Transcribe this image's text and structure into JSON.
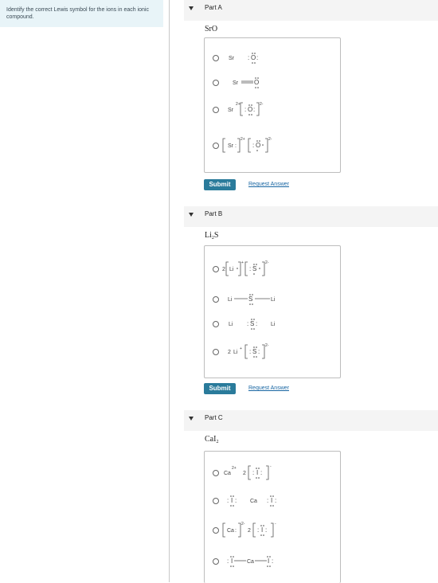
{
  "instructions": "Identify the correct Lewis symbol for the ions in each ionic compound.",
  "parts": [
    {
      "title": "Part A",
      "formula_main": "SrO",
      "formula_sub": "",
      "submit_label": "Submit",
      "request_label": "Request Answer",
      "options": [
        {
          "text": "Sr :O:"
        },
        {
          "text": "Sr=O"
        },
        {
          "text": "Sr 2+ [:O:] 2-"
        },
        {
          "text": "[Sr:] 2+ [:O·] 2-"
        }
      ]
    },
    {
      "title": "Part B",
      "formula_main": "Li",
      "formula_sub": "2",
      "formula_tail": "S",
      "submit_label": "Submit",
      "request_label": "Request Answer",
      "options": [
        {
          "text": "2[Li·]+ [:S·] 2-"
        },
        {
          "text": "Li—S—Li"
        },
        {
          "text": "Li :S: Li"
        },
        {
          "text": "2 Li+ [:S:] 2-"
        }
      ]
    },
    {
      "title": "Part C",
      "formula_main": "CaI",
      "formula_sub": "2",
      "formula_tail": "",
      "options": [
        {
          "text": "Ca 2+ 2[:I:] -"
        },
        {
          "text": ":I: Ca :I:"
        },
        {
          "text": "[Ca:] 2- 2[:I:] -"
        },
        {
          "text": ":I—Ca—I:"
        }
      ]
    }
  ],
  "symbols": {
    "Sr": "Sr",
    "O": "O",
    "Li": "Li",
    "S": "S",
    "Ca": "Ca",
    "I": "I",
    "two": "2",
    "charge_2plus": "2+",
    "charge_2minus": "2-",
    "charge_minus": "-",
    "charge_plus": "+"
  },
  "colors": {
    "submit": "#2a7b9b",
    "link": "#1a67a3",
    "panel": "#e8f4f8"
  }
}
